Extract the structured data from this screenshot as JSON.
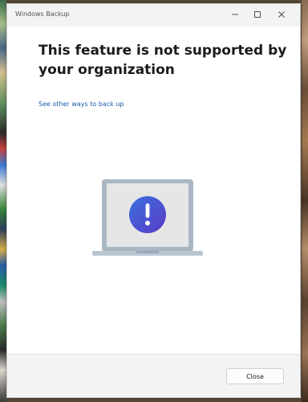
{
  "window": {
    "title": "Windows Backup"
  },
  "controls": {
    "minimize_icon": "minimize-icon",
    "maximize_icon": "maximize-icon",
    "close_icon": "close-icon"
  },
  "main": {
    "heading": "This feature is not supported by your organization",
    "link_text": "See other ways to back up",
    "illustration_icon": "laptop-warning-icon"
  },
  "footer": {
    "close_label": "Close"
  },
  "colors": {
    "link": "#1a5ba8",
    "warning_gradient_start": "#3b6fe0",
    "warning_gradient_end": "#5a3bc7",
    "laptop_frame": "#a9b7c4",
    "laptop_screen": "#e6e6e6"
  }
}
